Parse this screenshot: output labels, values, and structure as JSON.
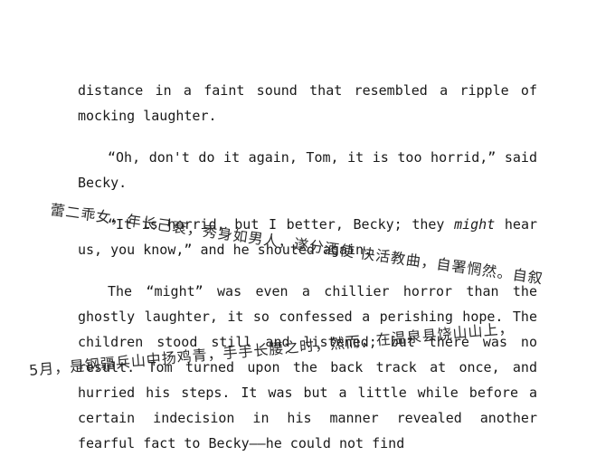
{
  "paragraphs": [
    {
      "text": "distance in a faint sound that resembled a ripple of mocking laughter."
    },
    {
      "text": "“Oh, don't do it again, Tom, it is too horrid,” said Becky."
    },
    {
      "before": "“It is horrid, but I better, Becky; they ",
      "emph": "might",
      "after": " hear us, you know,” and he shouted again."
    },
    {
      "text": "The “might” was even a chillier horror than the ghostly laughter, it so confessed a perishing hope. The children stood still and listened; but there was no result. Tom turned upon the back track at once, and hurried his steps. It was but a little while before a certain indecision in his manner revealed another fearful fact to Becky——he could not find"
    }
  ],
  "handwriting": {
    "line1": "蕾二乖女，年长己衰，秀身如男人，遂分酒使 快活教曲，自署惘然。自叙",
    "line2": "5月，是钢疆兵山中扬鸡青，手手长腰之时，然而，在温泉县饶山山上，"
  }
}
